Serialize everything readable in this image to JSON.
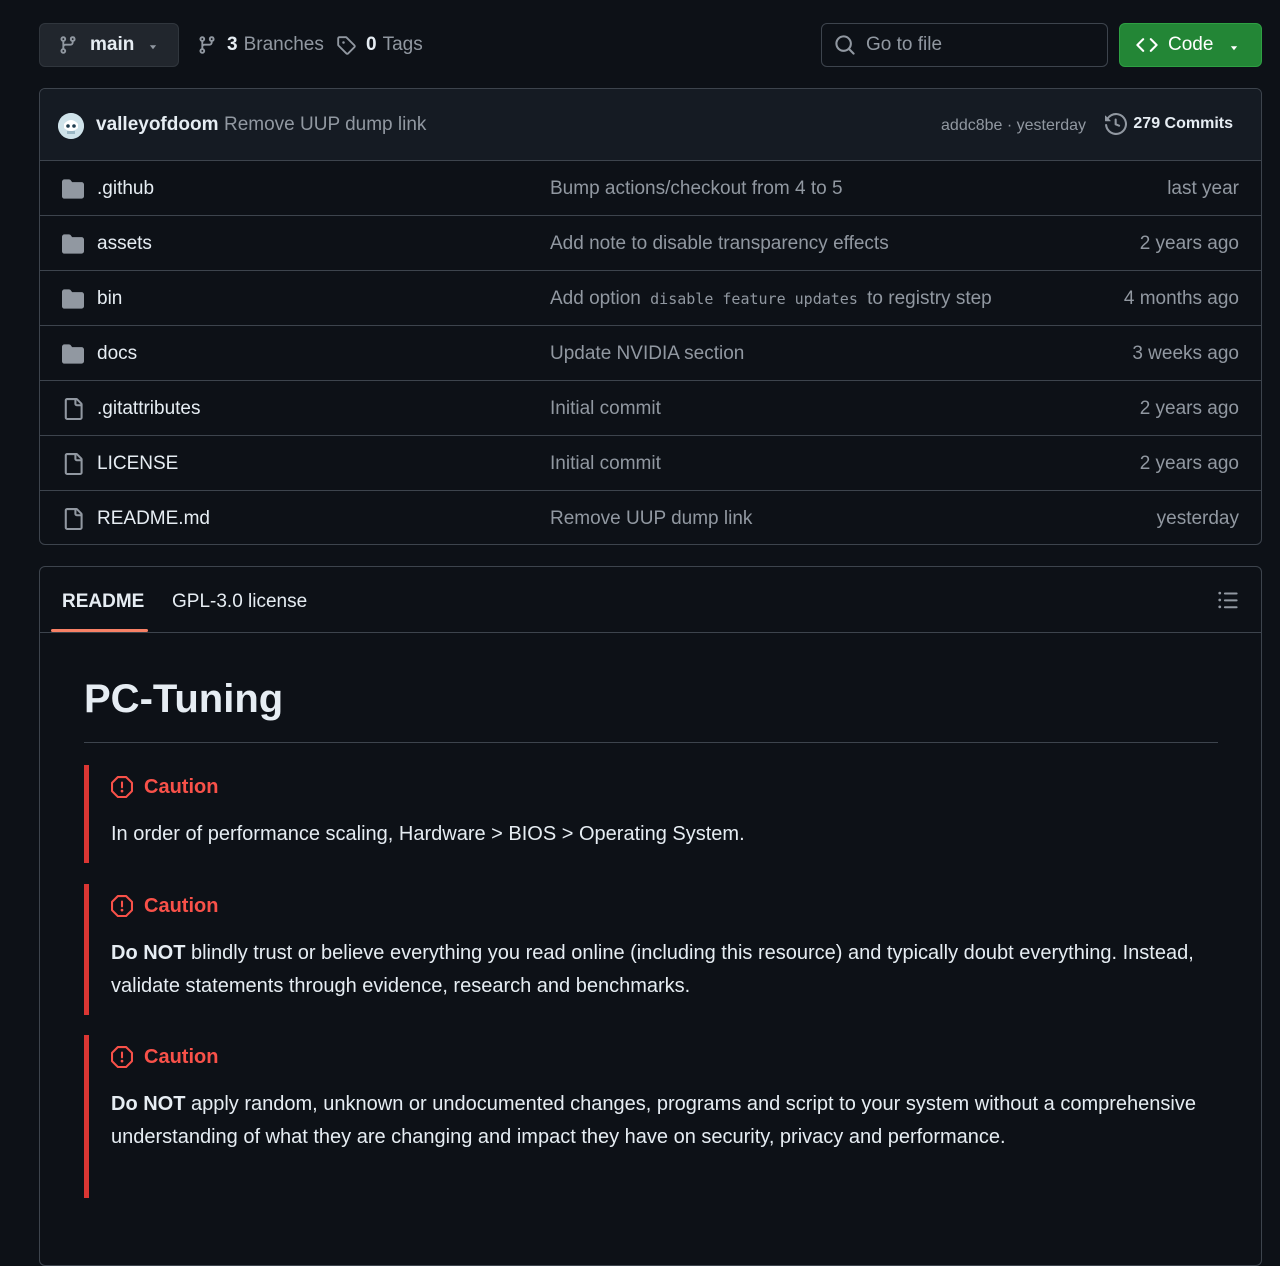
{
  "toolbar": {
    "branch": "main",
    "branches_count": "3",
    "branches_label": "Branches",
    "tags_count": "0",
    "tags_label": "Tags",
    "search_placeholder": "Go to file",
    "code_label": "Code"
  },
  "latest_commit": {
    "user": "valleyofdoom",
    "message": "Remove UUP dump link",
    "hash_time": "addc8be · yesterday",
    "commits_label": "279 Commits"
  },
  "files": [
    {
      "type": "folder",
      "name": ".github",
      "message": "Bump actions/checkout from 4 to 5",
      "date": "last year"
    },
    {
      "type": "folder",
      "name": "assets",
      "message": "Add note to disable transparency effects",
      "date": "2 years ago"
    },
    {
      "type": "folder",
      "name": "bin",
      "message_pre": "Add option",
      "message_code": "disable feature updates",
      "message_post": "to registry step",
      "date": "4 months ago"
    },
    {
      "type": "folder",
      "name": "docs",
      "message": "Update NVIDIA section",
      "date": "3 weeks ago"
    },
    {
      "type": "file",
      "name": ".gitattributes",
      "message": "Initial commit",
      "date": "2 years ago"
    },
    {
      "type": "file",
      "name": "LICENSE",
      "message": "Initial commit",
      "date": "2 years ago"
    },
    {
      "type": "file",
      "name": "README.md",
      "message": "Remove UUP dump link",
      "date": "yesterday"
    }
  ],
  "readme": {
    "tabs": [
      "README",
      "GPL-3.0 license"
    ],
    "title": "PC-Tuning",
    "alerts": [
      {
        "title": "Caution",
        "bold": "",
        "text": "In order of performance scaling, Hardware > BIOS > Operating System."
      },
      {
        "title": "Caution",
        "bold": "Do NOT",
        "text": " blindly trust or believe everything you read online (including this resource) and typically doubt everything. Instead, validate statements through evidence, research and benchmarks."
      },
      {
        "title": "Caution",
        "bold": "Do NOT",
        "text": " apply random, unknown or undocumented changes, programs and script to your system without a comprehensive understanding of what they are changing and impact they have on security, privacy and performance."
      }
    ]
  },
  "colors": {
    "background": "#0d1117",
    "accent_green": "#238636",
    "caution_red": "#f85149",
    "tab_underline": "#f78166"
  }
}
